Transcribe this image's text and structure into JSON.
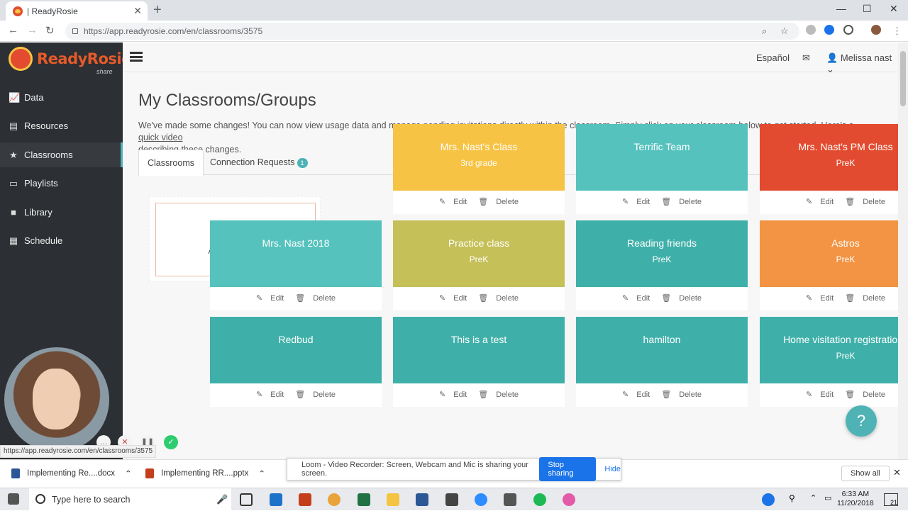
{
  "browser": {
    "tab_title": "| ReadyRosie",
    "url": "https://app.readyrosie.com/en/classrooms/3575"
  },
  "sidebar": {
    "logo_name": "ReadyRosie",
    "logo_sub": "share",
    "items": [
      {
        "label": "Data",
        "icon": "chart-icon"
      },
      {
        "label": "Resources",
        "icon": "document-icon"
      },
      {
        "label": "Classrooms",
        "icon": "star-icon"
      },
      {
        "label": "Playlists",
        "icon": "monitor-icon"
      },
      {
        "label": "Library",
        "icon": "video-icon"
      },
      {
        "label": "Schedule",
        "icon": "calendar-icon"
      }
    ],
    "active": "Classrooms"
  },
  "topbar": {
    "language": "Español",
    "user": "Melissa nast"
  },
  "page": {
    "title": "My Classrooms/Groups",
    "intro": "We've made some changes! You can now view usage data and manage pending invitations directly within the classroom. Simply click on your classroom below to get started. Here's a",
    "intro_link": "quick video",
    "intro_end": "describing these changes.",
    "tabs": [
      {
        "label": "Classrooms"
      },
      {
        "label": "Connection Requests",
        "badge": "1"
      }
    ],
    "add_label": "Add new class",
    "edit_label": "Edit",
    "delete_label": "Delete",
    "classes": [
      {
        "name": "Mrs. Nast's Class",
        "grade": "3rd grade",
        "color": "#f6c344"
      },
      {
        "name": "Terrific Team",
        "grade": "",
        "color": "#55c2bd"
      },
      {
        "name": "Mrs. Nast's PM Class",
        "grade": "PreK",
        "color": "#e24b2f"
      },
      {
        "name": "Mrs. Nast 2018",
        "grade": "",
        "color": "#55c2bd"
      },
      {
        "name": "Practice class",
        "grade": "PreK",
        "color": "#c5c058"
      },
      {
        "name": "Reading friends",
        "grade": "PreK",
        "color": "#3fb0a9"
      },
      {
        "name": "Astros",
        "grade": "PreK",
        "color": "#f29443"
      },
      {
        "name": "Redbud",
        "grade": "",
        "color": "#3fb0a9"
      },
      {
        "name": "This is a test",
        "grade": "",
        "color": "#3fb0a9"
      },
      {
        "name": "hamilton",
        "grade": "",
        "color": "#3fb0a9"
      },
      {
        "name": "Home visitation registrations",
        "grade": "PreK",
        "color": "#3fb0a9"
      }
    ]
  },
  "help_label": "?",
  "status_url": "https://app.readyrosie.com/en/classrooms/3575",
  "downloads": [
    {
      "name": "Implementing Re....docx",
      "color": "#2b5797"
    },
    {
      "name": "Implementing RR....pptx",
      "color": "#c43e1c"
    }
  ],
  "show_all": "Show all",
  "loom": {
    "message": "Loom - Video Recorder: Screen, Webcam and Mic is sharing your screen.",
    "stop": "Stop sharing",
    "hide": "Hide"
  },
  "taskbar": {
    "search": "Type here to search",
    "time": "6:33 AM",
    "date": "11/20/2018",
    "notifications": "21"
  }
}
